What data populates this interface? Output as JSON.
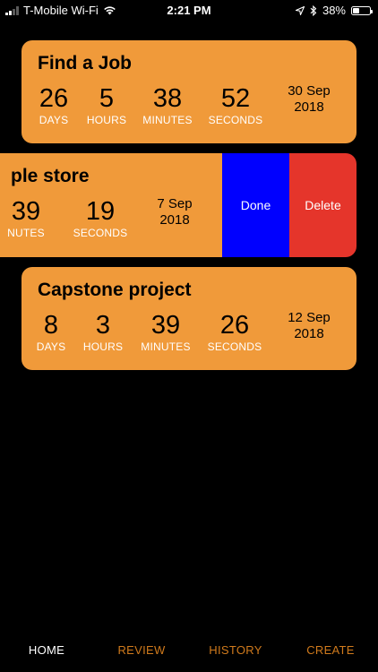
{
  "colors": {
    "card": "#f09a3a",
    "done": "#0000ff",
    "delete": "#e5352b",
    "tab_active": "#ffffff",
    "tab_inactive": "#d07a1c"
  },
  "status_bar": {
    "carrier": "T-Mobile Wi-Fi",
    "time": "2:21 PM",
    "battery": "38%",
    "battery_level": 0.38,
    "icons": [
      "signal-icon",
      "wifi-icon",
      "location-arrow-icon",
      "bluetooth-icon",
      "battery-icon"
    ]
  },
  "cards": [
    {
      "title": "Find a Job",
      "stats": [
        {
          "value": "26",
          "label": "DAYS"
        },
        {
          "value": "5",
          "label": "HOURS"
        },
        {
          "value": "38",
          "label": "MINUTES"
        },
        {
          "value": "52",
          "label": "SECONDS"
        }
      ],
      "date_line1": "30 Sep",
      "date_line2": "2018"
    },
    {
      "title": "ple store",
      "stats": [
        {
          "value": "39",
          "label": "NUTES"
        },
        {
          "value": "19",
          "label": "SECONDS"
        }
      ],
      "date_line1": "7 Sep",
      "date_line2": "2018",
      "actions": {
        "done": "Done",
        "delete": "Delete"
      }
    },
    {
      "title": "Capstone project",
      "stats": [
        {
          "value": "8",
          "label": "DAYS"
        },
        {
          "value": "3",
          "label": "HOURS"
        },
        {
          "value": "39",
          "label": "MINUTES"
        },
        {
          "value": "26",
          "label": "SECONDS"
        }
      ],
      "date_line1": "12 Sep",
      "date_line2": "2018"
    }
  ],
  "tabs": [
    {
      "label": "HOME",
      "active": true
    },
    {
      "label": "REVIEW",
      "active": false
    },
    {
      "label": "HISTORY",
      "active": false
    },
    {
      "label": "CREATE",
      "active": false
    }
  ]
}
